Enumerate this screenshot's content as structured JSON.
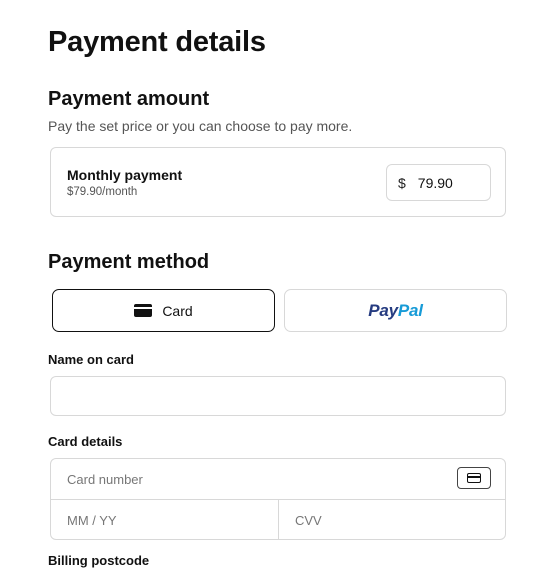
{
  "page": {
    "title": "Payment details"
  },
  "amount": {
    "heading": "Payment amount",
    "subtitle": "Pay the set price or you can choose to pay more.",
    "card_title": "Monthly payment",
    "card_subtitle": "$79.90/month",
    "currency_symbol": "$",
    "value": "79.90"
  },
  "method": {
    "heading": "Payment method",
    "card_label": "Card",
    "paypal_pay": "Pay",
    "paypal_pal": "Pal",
    "paypal_colors": {
      "pay": "#253b80",
      "pal": "#179bd7"
    },
    "selected": "Card"
  },
  "form": {
    "name_label": "Name on card",
    "name_value": "",
    "card_details_label": "Card details",
    "card_number_placeholder": "Card number",
    "expiry_placeholder": "MM / YY",
    "cvv_placeholder": "CVV",
    "next_label": "Billing postcode"
  }
}
